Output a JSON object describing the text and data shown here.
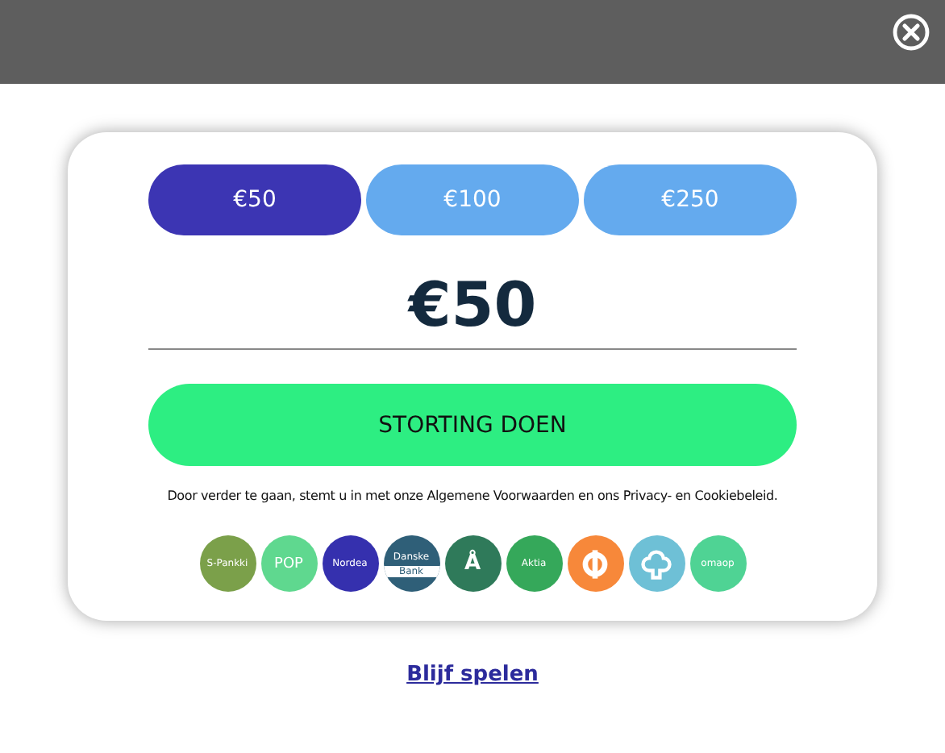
{
  "amounts": [
    {
      "label": "€50",
      "selected": true
    },
    {
      "label": "€100",
      "selected": false
    },
    {
      "label": "€250",
      "selected": false
    }
  ],
  "amount_value": "€50",
  "deposit_button": "STORTING DOEN",
  "terms": "Door verder te gaan, stemt u in met onze Algemene Voorwaarden en ons Privacy- en Cookiebeleid.",
  "banks": [
    {
      "kind": "text",
      "lines": [
        "S-Pankki"
      ],
      "color": "#7ba04a"
    },
    {
      "kind": "text",
      "lines": [
        "POP"
      ],
      "color": "#5fd88f"
    },
    {
      "kind": "text",
      "lines": [
        "Nordea"
      ],
      "color": "#3530ae"
    },
    {
      "kind": "split",
      "lines": [
        "Danske",
        "Bank"
      ],
      "color": "#2f5f78"
    },
    {
      "kind": "text",
      "lines": [
        "Å"
      ],
      "color": "#2f7a5a"
    },
    {
      "kind": "text",
      "lines": [
        "Aktia"
      ],
      "color": "#35a85a"
    },
    {
      "kind": "op",
      "color": "#f7883a"
    },
    {
      "kind": "tree",
      "color": "#6ec0d6"
    },
    {
      "kind": "text",
      "lines": [
        "omaop"
      ],
      "color": "#4fd394"
    }
  ],
  "continue_link": "Blijf spelen"
}
